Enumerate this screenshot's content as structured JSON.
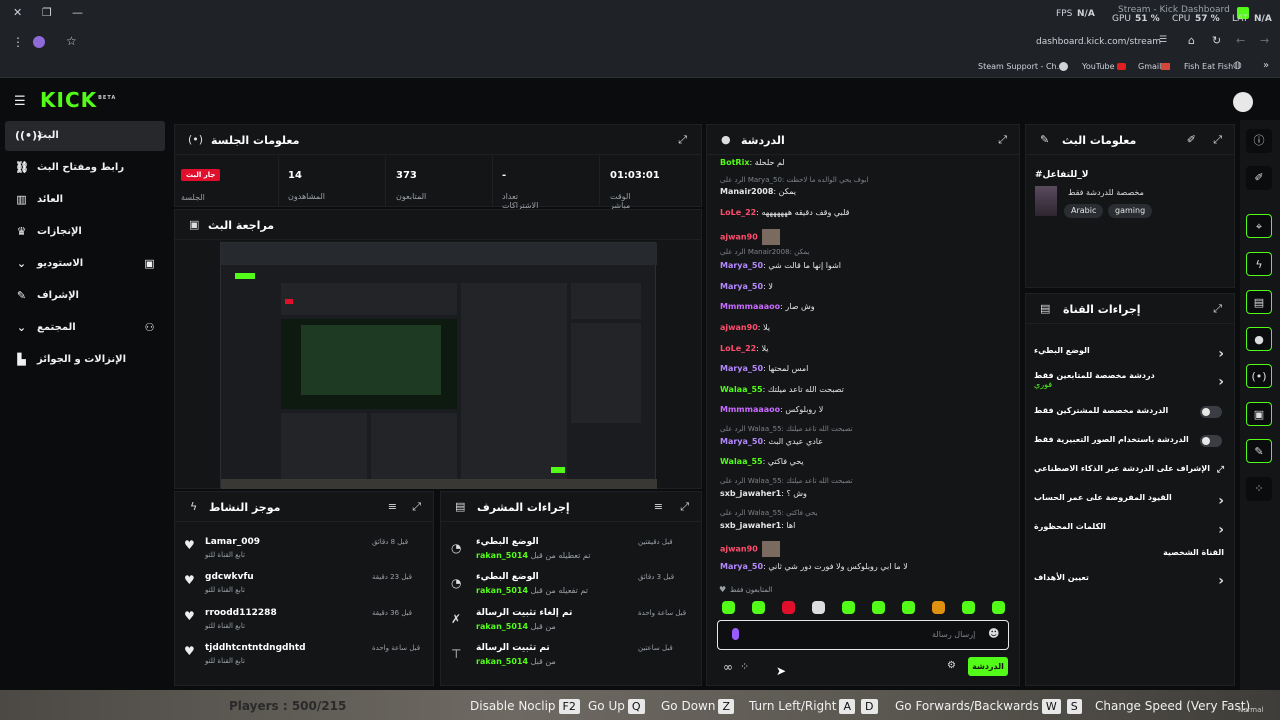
{
  "browser": {
    "tab_title": "Stream - Kick Dashboard",
    "url": "dashboard.kick.com/stream",
    "bookmarks": [
      "Steam Support - Ch...",
      "YouTube",
      "Gmail",
      "Fish Eat Fish"
    ],
    "overlay": {
      "fps_label": "FPS",
      "fps_val": "N/A",
      "gpu_label": "GPU",
      "gpu_val": "51 %",
      "cpu_label": "CPU",
      "cpu_val": "57 %",
      "lat_label": "LAT",
      "lat_val": "N/A"
    }
  },
  "kick": {
    "logo": "KICK",
    "beta": "BETA",
    "sidebar": [
      {
        "label": "البث",
        "icon": "live-icon"
      },
      {
        "label": "رابط ومفتاح البث",
        "icon": "link-icon"
      },
      {
        "label": "العائد",
        "icon": "chart-icon"
      },
      {
        "label": "الإنجازات",
        "icon": "trophy-icon"
      },
      {
        "label": "الاستوديو",
        "icon": "studio-icon"
      },
      {
        "label": "الإشراف",
        "icon": "wrench-icon"
      },
      {
        "label": "المجتمع",
        "icon": "community-icon"
      },
      {
        "label": "الإنزالات و الجوائز",
        "icon": "drops-icon"
      }
    ],
    "session": {
      "title": "معلومات الجلسة",
      "live_badge": "جار البث",
      "live_label": "الجلسة",
      "stats": [
        {
          "value": "14",
          "label": "المشاهدون"
        },
        {
          "value": "373",
          "label": "المتابعون"
        },
        {
          "value": "-",
          "label": "تعداد الاشتراكات"
        },
        {
          "value": "01:03:01",
          "label": "الوقت مباشر"
        }
      ]
    },
    "preview": {
      "title": "مراجعة البث"
    },
    "activity": {
      "title": "موجز النشاط",
      "items": [
        {
          "user": "Lamar_009",
          "sub": "تابع القناة للتو",
          "time": "قبل 8 دقائق"
        },
        {
          "user": "gdcwkvfu",
          "sub": "تابع القناة للتو",
          "time": "قبل 23 دقيقة"
        },
        {
          "user": "rroodd112288",
          "sub": "تابع القناة للتو",
          "time": "قبل 36 دقيقة"
        },
        {
          "user": "tjddhtcntntdngdhtd",
          "sub": "تابع القناة للتو",
          "time": "قبل ساعة واحدة"
        }
      ]
    },
    "modactions": {
      "title": "إجراءات المشرف",
      "items": [
        {
          "action": "الوضع البطيء",
          "by_prefix": "تم تعطيله من قبل",
          "by": "rakan_5014",
          "time": "قبل دقيقتين"
        },
        {
          "action": "الوضع البطيء",
          "by_prefix": "تم تفعيله من قبل",
          "by": "rakan_5014",
          "time": "قبل 3 دقائق"
        },
        {
          "action": "تم إلغاء تثبيت الرسالة",
          "by_prefix": "من قبل",
          "by": "rakan_5014",
          "time": "قبل ساعة واحدة"
        },
        {
          "action": "تم تثبيت الرسالة",
          "by_prefix": "من قبل",
          "by": "rakan_5014",
          "time": "قبل ساعتين"
        }
      ]
    },
    "chat": {
      "title": "الدردشة",
      "placeholder": "إرسال رسالة",
      "send": "الدردشة",
      "followers_only": "المتابعون فقط",
      "messages": [
        {
          "reply": "",
          "user": "BotRix",
          "color": "#53fc18",
          "text": "لم حلحلة"
        },
        {
          "reply": "الرد على Marya_50: ابوف يحي الوالده ما لاحظت",
          "user": "",
          "color": "",
          "text": ""
        },
        {
          "reply": "",
          "user": "Manair2008",
          "color": "#e6e6e6",
          "text": "يمكن"
        },
        {
          "reply": "",
          "user": "LoLe_22",
          "color": "#ff4d6d",
          "text": "قلبي وقف دقيقه هههههههه"
        },
        {
          "reply": "",
          "user": "ajwan90",
          "color": "#ff4d6d",
          "text": ""
        },
        {
          "reply": "الرد على Manair2008: يمكن",
          "user": "",
          "color": "",
          "text": ""
        },
        {
          "reply": "",
          "user": "Marya_50",
          "color": "#b388ff",
          "text": "اشوا إنها ما قالت شي"
        },
        {
          "reply": "",
          "user": "Marya_50",
          "color": "#b388ff",
          "text": "لا"
        },
        {
          "reply": "",
          "user": "Mmmmaaaoo",
          "color": "#c86bff",
          "text": "وش صار"
        },
        {
          "reply": "",
          "user": "ajwan90",
          "color": "#ff4d6d",
          "text": "يلا"
        },
        {
          "reply": "",
          "user": "LoLe_22",
          "color": "#ff4d6d",
          "text": "يلا"
        },
        {
          "reply": "",
          "user": "Marya_50",
          "color": "#b388ff",
          "text": "امس لمحتها"
        },
        {
          "reply": "",
          "user": "Walaa_55",
          "color": "#53fc18",
          "text": "تصبحت الله تاعد ميلتك"
        },
        {
          "reply": "",
          "user": "Mmmmaaaoo",
          "color": "#c86bff",
          "text": "لا روبلوكس"
        },
        {
          "reply": "الرد على Walaa_55: تصبحت الله تاعد ميلتك",
          "user": "",
          "color": "",
          "text": ""
        },
        {
          "reply": "",
          "user": "Marya_50",
          "color": "#b388ff",
          "text": "عادي عيدي البث"
        },
        {
          "reply": "",
          "user": "Walaa_55",
          "color": "#53fc18",
          "text": "يحي فاكتي"
        },
        {
          "reply": "الرد على Walaa_55: تصبحت الله تاعد ميلتك",
          "user": "",
          "color": "",
          "text": ""
        },
        {
          "reply": "",
          "user": "sxb_jawaher1",
          "color": "#e6e6e6",
          "text": "وش ؟"
        },
        {
          "reply": "الرد على Walaa_55: يحي فاكتي",
          "user": "",
          "color": "",
          "text": ""
        },
        {
          "reply": "",
          "user": "sxb_jawaher1",
          "color": "#e6e6e6",
          "text": "اها"
        },
        {
          "reply": "",
          "user": "ajwan90",
          "color": "#ff4d6d",
          "text": ""
        },
        {
          "reply": "",
          "user": "Marya_50",
          "color": "#b388ff",
          "text": "لا ما ابي روبلوكس ولا فورت دور شي ثاني"
        }
      ]
    },
    "stream_info": {
      "title": "معلومات البث",
      "stream_title": "#لا_للتفاعل",
      "category": "مخصصة للدردشة فقط",
      "tags": [
        "Arabic",
        "gaming"
      ]
    },
    "channel_actions": {
      "title": "إجراءات القناة",
      "items": [
        {
          "label": "الوضع البطيء",
          "sub": "",
          "type": "arrow"
        },
        {
          "label": "دردشة مخصصة للمتابعين فقط",
          "sub": "فوري",
          "type": "arrow"
        },
        {
          "label": "الدردشة مخصصة للمشتركين فقط",
          "sub": "",
          "type": "toggle"
        },
        {
          "label": "الدردشة باستخدام الصور التعبيرية فقط",
          "sub": "",
          "type": "toggle"
        },
        {
          "label": "الإشراف على الدردشة عبر الذكاء الاصطناعي",
          "sub": "",
          "type": "external"
        },
        {
          "label": "القيود المفروضة على عمر الحساب",
          "sub": "",
          "type": "arrow"
        },
        {
          "label": "الكلمات المحظورة",
          "sub": "",
          "type": "arrow"
        },
        {
          "label": "القناة الشخصية",
          "sub": "",
          "type": "none"
        },
        {
          "label": "تعيين الأهداف",
          "sub": "",
          "type": "arrow"
        }
      ]
    }
  },
  "game": {
    "players": "Players : 500/215",
    "hints": [
      {
        "label": "Disable Noclip",
        "keys": [
          "F2"
        ]
      },
      {
        "label": "Go Up",
        "keys": [
          "Q"
        ]
      },
      {
        "label": "Go Down",
        "keys": [
          "Z"
        ]
      },
      {
        "label": "Turn Left/Right",
        "keys": [
          "A",
          "D"
        ]
      },
      {
        "label": "Go Forwards/Backwards",
        "keys": [
          "W",
          "S"
        ]
      },
      {
        "label": "Change Speed (Very Fast)",
        "keys": []
      }
    ],
    "watermark": "Normal"
  },
  "colors": {
    "accent": "#53fc18",
    "bg": "#0b0c0d",
    "panel": "#141517",
    "live": "#e0102d"
  }
}
